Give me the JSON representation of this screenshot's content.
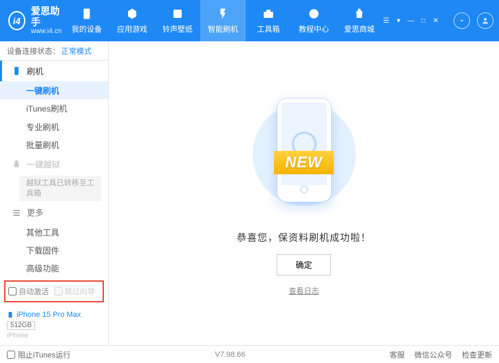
{
  "header": {
    "logo_text": "爱思助手",
    "logo_url": "www.i4.cn",
    "logo_mark": "i4",
    "nav": [
      {
        "label": "我的设备",
        "icon": "phone"
      },
      {
        "label": "应用游戏",
        "icon": "apps"
      },
      {
        "label": "铃声壁纸",
        "icon": "wallpaper"
      },
      {
        "label": "智能刷机",
        "icon": "flash",
        "active": true
      },
      {
        "label": "工具箱",
        "icon": "toolbox"
      },
      {
        "label": "教程中心",
        "icon": "book"
      },
      {
        "label": "爱思商城",
        "icon": "store"
      }
    ]
  },
  "sidebar": {
    "status_label": "设备连接状态：",
    "status_mode": "正常模式",
    "flash_group": "刷机",
    "flash_items": [
      "一键刷机",
      "iTunes刷机",
      "专业刷机",
      "批量刷机"
    ],
    "jailbreak_group": "一键越狱",
    "jailbreak_note": "越狱工具已转移至工具箱",
    "more_group": "更多",
    "more_items": [
      "其他工具",
      "下载固件",
      "高级功能"
    ],
    "options": {
      "auto_activate": "自动激活",
      "skip_guide": "跳过向导"
    },
    "device": {
      "name": "iPhone 15 Pro Max",
      "storage": "512GB",
      "type": "iPhone"
    }
  },
  "main": {
    "banner_text": "NEW",
    "success_msg": "恭喜您，保资料刷机成功啦！",
    "ok_btn": "确定",
    "log_link": "查看日志"
  },
  "footer": {
    "block_itunes": "阻止iTunes运行",
    "version": "V7.98.66",
    "links": [
      "客服",
      "微信公众号",
      "检查更新"
    ]
  }
}
